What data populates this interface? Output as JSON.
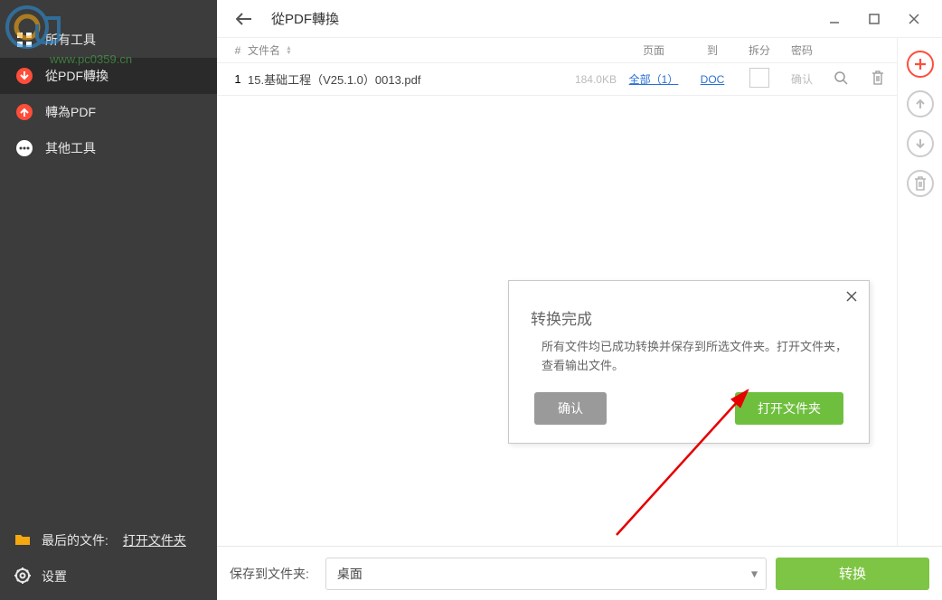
{
  "watermark": {
    "url_text": "www.pc0359.cn"
  },
  "sidebar": {
    "items": [
      {
        "label": "所有工具"
      },
      {
        "label": "從PDF轉換"
      },
      {
        "label": "轉為PDF"
      },
      {
        "label": "其他工具"
      }
    ],
    "recent_label": "最后的文件:",
    "open_folder_label": "打开文件夹",
    "settings_label": "设置"
  },
  "header": {
    "title": "從PDF轉換"
  },
  "table": {
    "columns": {
      "index": "#",
      "name": "文件名",
      "pages": "页面",
      "target": "到",
      "split": "拆分",
      "password": "密码"
    },
    "rows": [
      {
        "index": "1",
        "name": "15.基础工程（V25.1.0）0013.pdf",
        "size": "184.0KB",
        "pages_link": "全部（1）",
        "target_link": "DOC",
        "password_label": "确认"
      }
    ]
  },
  "dialog": {
    "title": "转换完成",
    "message": "所有文件均已成功转换并保存到所选文件夹。打开文件夹，查看输出文件。",
    "ok_label": "确认",
    "primary_label": "打开文件夹"
  },
  "footer": {
    "save_label": "保存到文件夹:",
    "save_value": "桌面",
    "convert_label": "转换"
  }
}
